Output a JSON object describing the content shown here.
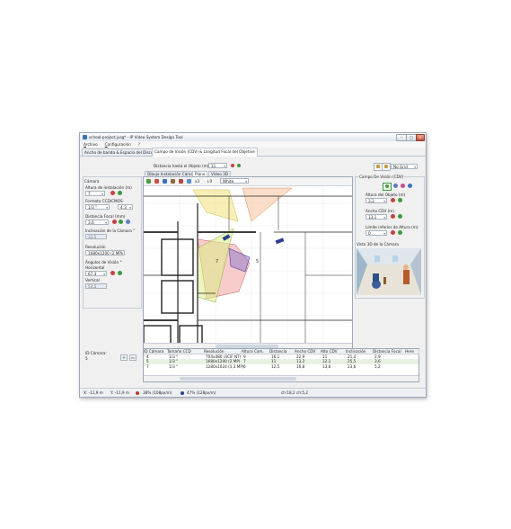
{
  "window": {
    "title": "school-project.jvsg* - IP Video System Design Tool"
  },
  "menu": [
    "Archivo",
    "Configuración",
    "?"
  ],
  "main_tabs": [
    "Ancho de banda & Espacio del Disco",
    "Campo de Visión (CDV) & Longitud Focal del Objetive"
  ],
  "toolbar_right": {
    "grid_select": "No Grid"
  },
  "distance": {
    "label": "Distancia hasta el Objeto (m)",
    "value": "11"
  },
  "camera_panel": {
    "title": "Cámara",
    "height_label": "Altura de instalación (m)",
    "height_value": "7",
    "ccd_label": "Formato CCD/CMOS",
    "ccd_value": "1/3 \"",
    "ccd_value2": "4:3",
    "focal_label": "Distancia Focal (mm)",
    "focal_value": "3,6",
    "tilt_label": "Inclinación de la Cámara °",
    "tilt_value": "33,5",
    "res_label": "Resolución",
    "res_value": "1680x1200 (2 MP)",
    "angles_label": "Ángulos de Visión °",
    "horizontal_label": "Horizontal",
    "horizontal_value": "67,3",
    "vertical_label": "Vertical",
    "vertical_value": "53,5"
  },
  "inner_tabs": [
    "Dibujo Instalación Cámara",
    "Plano",
    "Vídeo 3D"
  ],
  "plan_toolbar": {
    "zoom": "3",
    "layer": "0",
    "color": "White"
  },
  "fov_panel": {
    "title": "Campo De Visión (CDV)",
    "object_height_label": "Altura del Objeto (m)",
    "object_height_value": "3,2",
    "width_label": "Ancho CDV (m)",
    "width_value": "13,1",
    "lower_label": "Límite inferior de Altura (m)",
    "lower_value": "0",
    "view3d_label": "Vista 3D de la Cámara"
  },
  "camera_id": {
    "label": "ID Cámara:",
    "value": "5"
  },
  "table": {
    "columns": [
      "ID Cámara",
      "Tamaño CCD",
      "Resolución",
      "Altura Cam.",
      "Distancia",
      "Ancho CDV",
      "Alto CDV",
      "Inclinación",
      "Distancia Focal",
      "Here"
    ],
    "rows": [
      [
        "4",
        "1/3 \"",
        "704x480 (4CIF NT)",
        "9",
        "16,1",
        "22,9",
        "11",
        "21,4",
        "2,9"
      ],
      [
        "5",
        "1/3 \"",
        "1680x1200 (2 MP)",
        "7",
        "11",
        "13,2",
        "12,1",
        "25,5",
        "3,6"
      ],
      [
        "7",
        "1/3 \"",
        "1280x1024 (1,3 MP)",
        "6",
        "12,5",
        "16,8",
        "13,6",
        "23,6",
        "5,2"
      ]
    ]
  },
  "status": {
    "x": "X: -11,9 m",
    "y": "Y: -11,9 m",
    "px1": "38% (108px/m)",
    "px2": "47% (128px/m)",
    "ch": "ch:18,2 ch:5,2"
  },
  "colors": {
    "accent": "#3a6fb5",
    "status_red": "#c0392b",
    "status_green": "#3c9a3c"
  }
}
